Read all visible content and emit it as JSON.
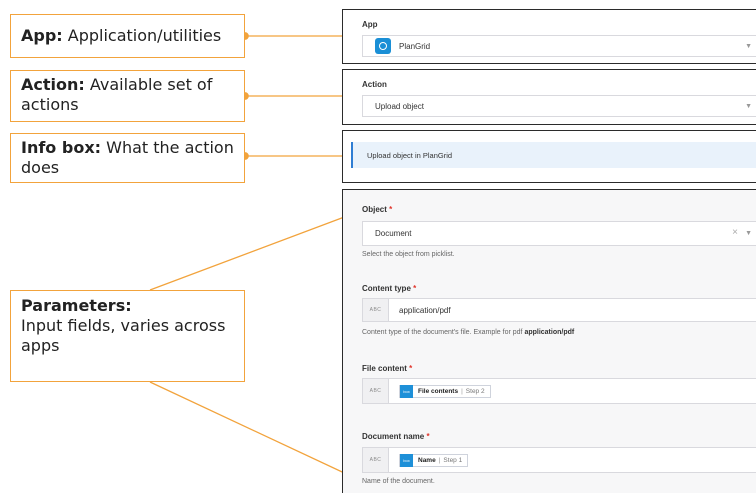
{
  "callouts": {
    "app": {
      "title": "App:",
      "text": "Application/utilities"
    },
    "action": {
      "title": "Action:",
      "text": "Available set of actions"
    },
    "info": {
      "title": "Info box:",
      "text": "What the action does"
    },
    "params": {
      "title": "Parameters:",
      "text": "Input fields, varies across apps"
    }
  },
  "form": {
    "app": {
      "label": "App",
      "value": "PlanGrid"
    },
    "action": {
      "label": "Action",
      "value": "Upload object"
    },
    "info": {
      "text": "Upload object in PlanGrid"
    },
    "object": {
      "label": "Object",
      "required": "*",
      "value": "Document",
      "clear": "×",
      "help": "Select the object from picklist."
    },
    "content_type": {
      "label": "Content type",
      "required": "*",
      "type_tag": "ABC",
      "value": "application/pdf",
      "help_prefix": "Content type of the document's file. Example for pdf",
      "help_bold": "application/pdf"
    },
    "file_content": {
      "label": "File content",
      "required": "*",
      "type_tag": "ABC",
      "pill_icon": "box",
      "pill_label": "File contents",
      "pill_step": "Step 2"
    },
    "document_name": {
      "label": "Document name",
      "required": "*",
      "type_tag": "ABC",
      "pill_icon": "box",
      "pill_label": "Name",
      "pill_step": "Step 1",
      "help": "Name of the document."
    }
  },
  "colors": {
    "callout_border": "#f2a33c",
    "accent_blue": "#1a8fd6",
    "required": "#e0352b"
  }
}
